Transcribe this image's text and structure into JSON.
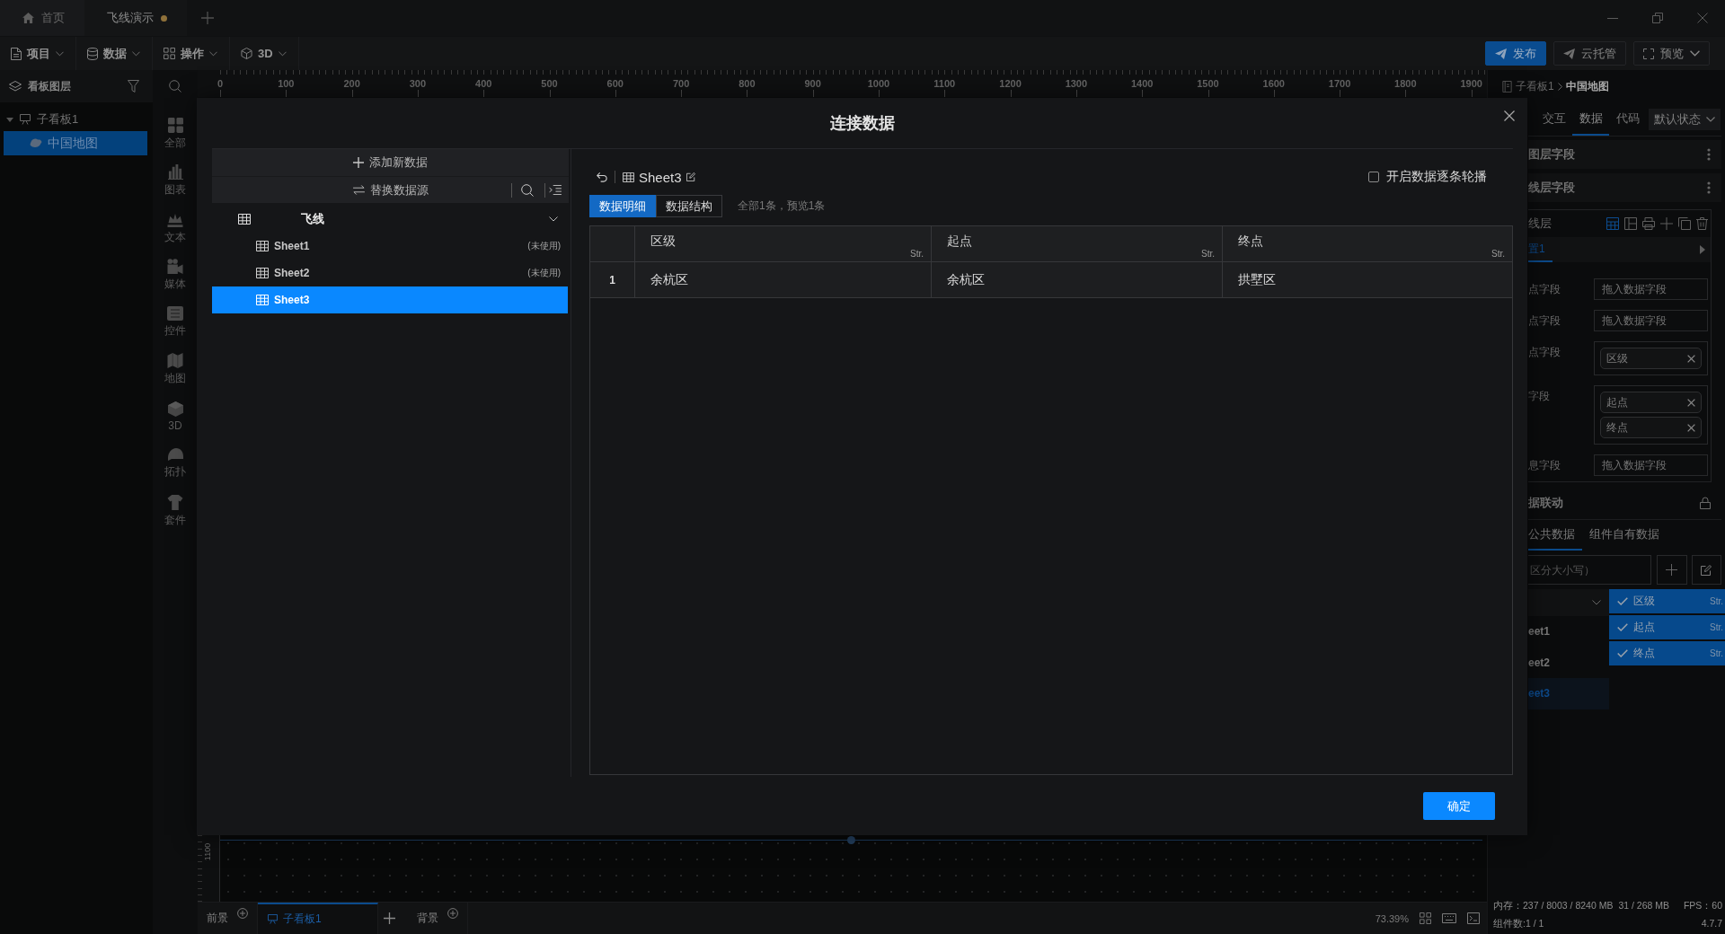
{
  "title_bar": {
    "tabs": [
      {
        "label": "首页",
        "kind": "home",
        "selected": false,
        "modified": false
      },
      {
        "label": "飞线演示",
        "kind": "project",
        "selected": true,
        "modified": true
      }
    ]
  },
  "toolbar": {
    "menus": [
      "项目",
      "数据",
      "操作",
      "3D"
    ],
    "actions": [
      {
        "label": "发布",
        "kind": "primary"
      },
      {
        "label": "云托管",
        "kind": "plain"
      },
      {
        "label": "预览",
        "kind": "dropdown"
      }
    ]
  },
  "layers_panel": {
    "title": "看板图层",
    "tree": [
      {
        "label": "子看板1",
        "expanded": true,
        "selected": false,
        "children": [
          {
            "label": "中国地图",
            "selected": true
          }
        ]
      }
    ]
  },
  "component_library": [
    "全部",
    "图表",
    "文本",
    "媒体",
    "控件",
    "地图",
    "3D",
    "拓扑",
    "套件"
  ],
  "canvas": {
    "ruler_labels": [
      "0",
      "100",
      "200",
      "300",
      "400",
      "500",
      "600",
      "700",
      "800",
      "900",
      "1000",
      "1100",
      "1200",
      "1300",
      "1400",
      "1500",
      "1600",
      "1700",
      "1800",
      "1900"
    ],
    "side_ruler_label": "1100"
  },
  "layer_bar": {
    "tabs": [
      {
        "label": "前景",
        "kind": "layer",
        "selected": false
      },
      {
        "label": "子看板1",
        "kind": "board",
        "selected": true
      },
      {
        "label": "背景",
        "kind": "layer",
        "selected": false
      }
    ],
    "zoom": "73.39%"
  },
  "properties_panel": {
    "breadcrumb": [
      "子看板1",
      "中国地图"
    ],
    "tabs": [
      {
        "label": "交互",
        "selected": false
      },
      {
        "label": "数据",
        "selected": true
      },
      {
        "label": "代码",
        "selected": false
      }
    ],
    "state_select": "默认状态",
    "sections": [
      "图层字段",
      "线层字段"
    ],
    "layer_card": {
      "title": "线层",
      "config_tabs": [
        {
          "label": "置1",
          "selected": true
        }
      ],
      "fields": [
        {
          "label": "点字段",
          "kind": "input",
          "placeholder": "拖入数据字段"
        },
        {
          "label": "点字段",
          "kind": "input",
          "placeholder": "拖入数据字段"
        },
        {
          "label": "点字段",
          "kind": "tags",
          "tags": [
            "区级"
          ]
        },
        {
          "label": "字段",
          "kind": "tags",
          "tags": [
            "起点",
            "终点"
          ]
        },
        {
          "label": "息字段",
          "kind": "input",
          "placeholder": "拖入数据字段"
        }
      ]
    },
    "linkage_title": "据联动",
    "source_tabs": [
      {
        "label": "公共数据",
        "selected": true
      },
      {
        "label": "组件自有数据",
        "selected": false
      }
    ],
    "search": {
      "placeholder": "区分大小写）"
    },
    "sheets": [
      {
        "label": "eet1",
        "selected": false
      },
      {
        "label": "eet2",
        "selected": false
      },
      {
        "label": "eet3",
        "selected": true
      }
    ],
    "field_list": [
      {
        "label": "区级",
        "type": "Str.",
        "checked": true
      },
      {
        "label": "起点",
        "type": "Str.",
        "checked": true
      },
      {
        "label": "终点",
        "type": "Str.",
        "checked": true
      }
    ]
  },
  "status_bar": {
    "memory": "内存：237 / 8003 / 8240 MB",
    "heap": "31 / 268 MB",
    "fps": "FPS：60",
    "components": "组件数:1 / 1",
    "version": "4.7.7"
  },
  "dialog": {
    "title": "连接数据",
    "add_button": "添加新数据",
    "replace_button": "替换数据源",
    "sources": [
      {
        "label": "飞线",
        "expanded": true,
        "children": [
          {
            "label": "Sheet1",
            "status": "(未使用)",
            "selected": false
          },
          {
            "label": "Sheet2",
            "status": "(未使用)",
            "selected": false
          },
          {
            "label": "Sheet3",
            "selected": true
          }
        ]
      }
    ],
    "sheet_title": "Sheet3",
    "carousel": {
      "label": "开启数据逐条轮播",
      "checked": false
    },
    "view_tabs": [
      {
        "label": "数据明细",
        "selected": true
      },
      {
        "label": "数据结构",
        "selected": false
      }
    ],
    "summary": "全部1条，预览1条",
    "table": {
      "columns": [
        {
          "name": "区级",
          "type": "Str."
        },
        {
          "name": "起点",
          "type": "Str."
        },
        {
          "name": "终点",
          "type": "Str."
        }
      ],
      "rows": [
        {
          "index": "1",
          "cells": [
            "余杭区",
            "余杭区",
            "拱墅区"
          ]
        }
      ]
    },
    "confirm_button": "确定"
  }
}
